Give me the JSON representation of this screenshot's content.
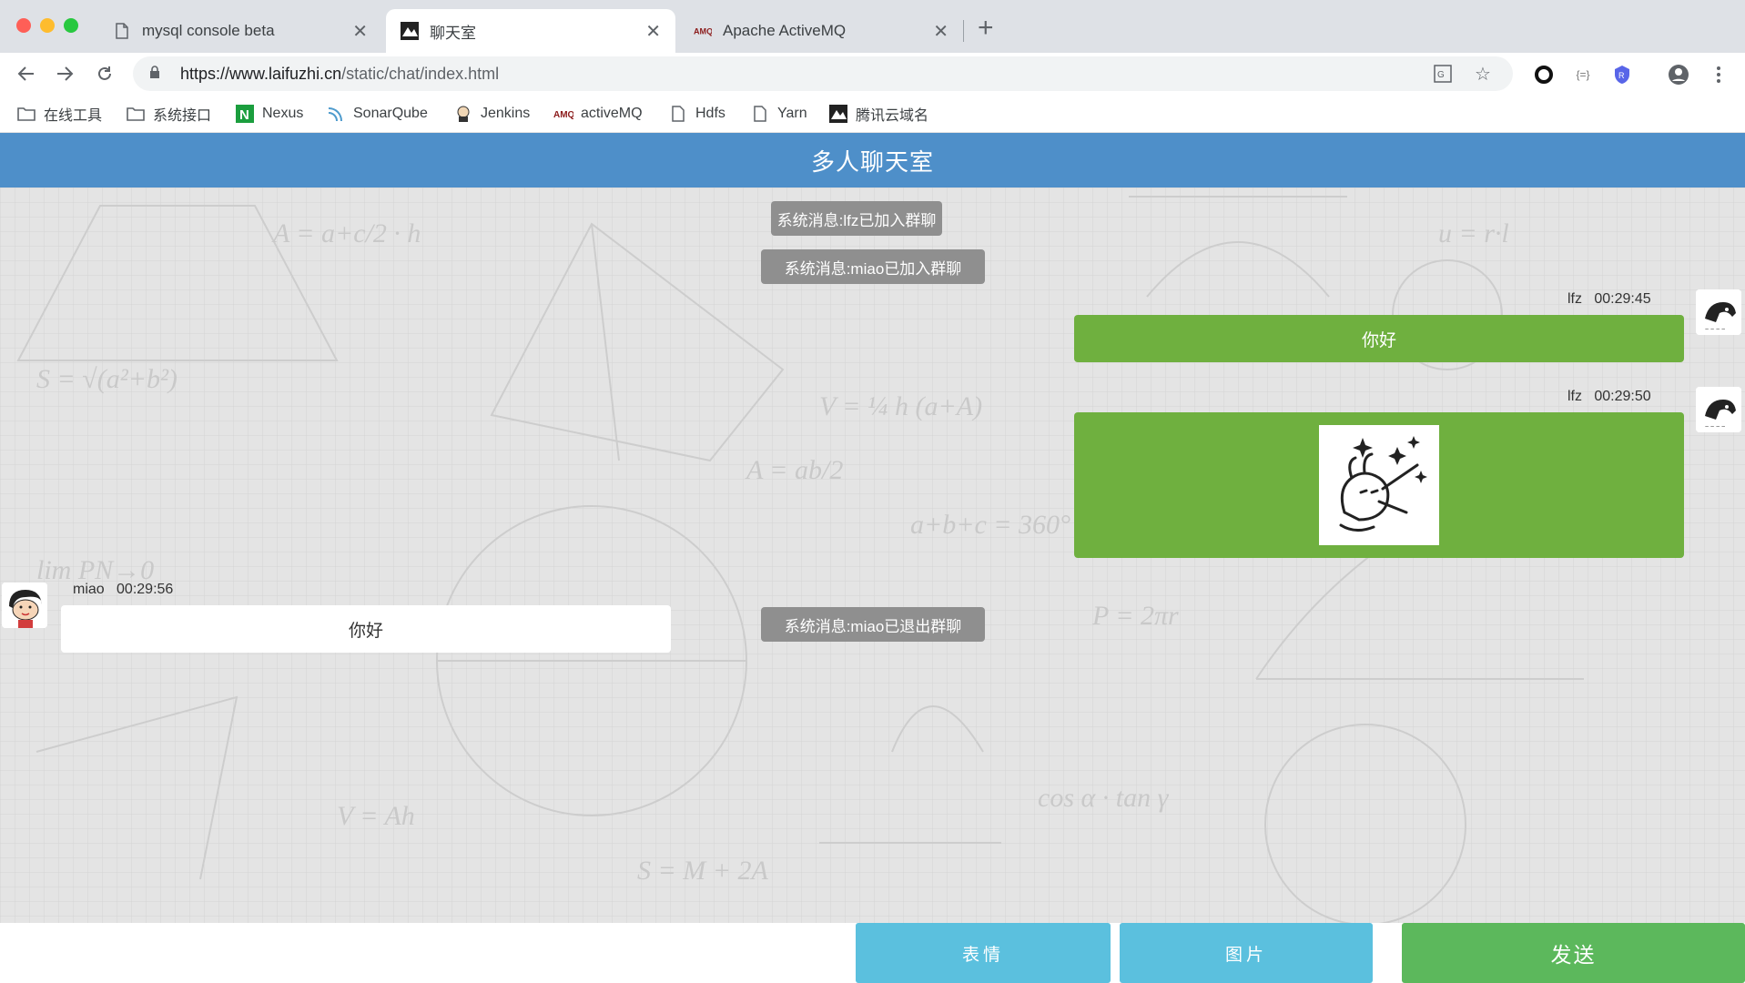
{
  "browser": {
    "tabs": [
      {
        "title": "mysql console beta",
        "icon": "page-icon"
      },
      {
        "title": "聊天室",
        "icon": "site-favicon"
      },
      {
        "title": "Apache ActiveMQ",
        "icon": "amq-icon"
      }
    ],
    "url_host": "https://www.laifuzhi.cn",
    "url_path": "/static/chat/index.html",
    "bookmarks": [
      {
        "label": "在线工具",
        "icon": "folder-icon"
      },
      {
        "label": "系统接口",
        "icon": "folder-icon"
      },
      {
        "label": "Nexus",
        "icon": "nexus-icon"
      },
      {
        "label": "SonarQube",
        "icon": "sonarqube-icon"
      },
      {
        "label": "Jenkins",
        "icon": "jenkins-icon"
      },
      {
        "label": "activeMQ",
        "icon": "amq-icon"
      },
      {
        "label": "Hdfs",
        "icon": "page-icon"
      },
      {
        "label": "Yarn",
        "icon": "page-icon"
      },
      {
        "label": "腾讯云域名",
        "icon": "site-favicon"
      }
    ]
  },
  "chat": {
    "title": "多人聊天室",
    "system_messages": [
      "系统消息:lfz已加入群聊",
      "系统消息:miao已加入群聊",
      "系统消息:miao已退出群聊"
    ],
    "messages": [
      {
        "user": "lfz",
        "time": "00:29:45",
        "text": "你好",
        "side": "right"
      },
      {
        "user": "lfz",
        "time": "00:29:50",
        "text": "",
        "type": "sticker",
        "side": "right"
      },
      {
        "user": "miao",
        "time": "00:29:56",
        "text": "你好",
        "side": "left"
      }
    ],
    "input_value": "",
    "buttons": {
      "emoji": "表情",
      "image": "图片",
      "send": "发送"
    }
  },
  "colors": {
    "header": "#4e8fc9",
    "bubble_green": "#6fb03f",
    "button_blue": "#5bc0de",
    "button_green": "#5cb85c",
    "system_message": "#8f8f8f"
  }
}
